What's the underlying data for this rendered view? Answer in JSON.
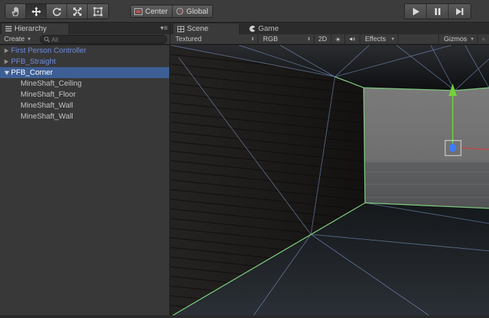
{
  "toolbar": {
    "tools": [
      {
        "name": "hand-tool",
        "icon": "hand-icon",
        "active": false
      },
      {
        "name": "move-tool",
        "icon": "move-arrows-icon",
        "active": true
      },
      {
        "name": "rotate-tool",
        "icon": "rotate-icon",
        "active": false
      },
      {
        "name": "scale-tool",
        "icon": "scale-icon",
        "active": false
      },
      {
        "name": "rect-tool",
        "icon": "rect-transform-icon",
        "active": false
      }
    ],
    "pivot_label": "Center",
    "space_label": "Global",
    "playback": [
      "play-icon",
      "pause-icon",
      "step-icon"
    ]
  },
  "hierarchy": {
    "tab_label": "Hierarchy",
    "create_label": "Create",
    "search_placeholder": "All",
    "items": [
      {
        "label": "First Person Controller",
        "type": "prefab",
        "expanded": false
      },
      {
        "label": "PFB_Straight",
        "type": "prefab",
        "expanded": false
      },
      {
        "label": "PFB_Corner",
        "type": "prefab",
        "expanded": true,
        "selected": true
      },
      {
        "label": "MineShaft_Ceiling",
        "type": "child"
      },
      {
        "label": "MineShaft_Floor",
        "type": "child"
      },
      {
        "label": "MineShaft_Wall",
        "type": "child"
      },
      {
        "label": "MineShaft_Wall",
        "type": "child"
      }
    ]
  },
  "scene": {
    "tabs": [
      {
        "label": "Scene",
        "icon": "grid-icon",
        "active": true
      },
      {
        "label": "Game",
        "icon": "pacman-icon",
        "active": false
      }
    ],
    "draw_mode": "Textured",
    "render_mode": "RGB",
    "toggle_2d": "2D",
    "effects_label": "Effects",
    "gizmos_label": "Gizmos"
  },
  "colors": {
    "selection": "#3e5f96",
    "prefab_text": "#6f8cdc",
    "wireframe": "#7d97c8",
    "selection_outline": "#7fd17f",
    "gizmo_y": "#73d13b",
    "gizmo_z": "#3d7cff"
  }
}
